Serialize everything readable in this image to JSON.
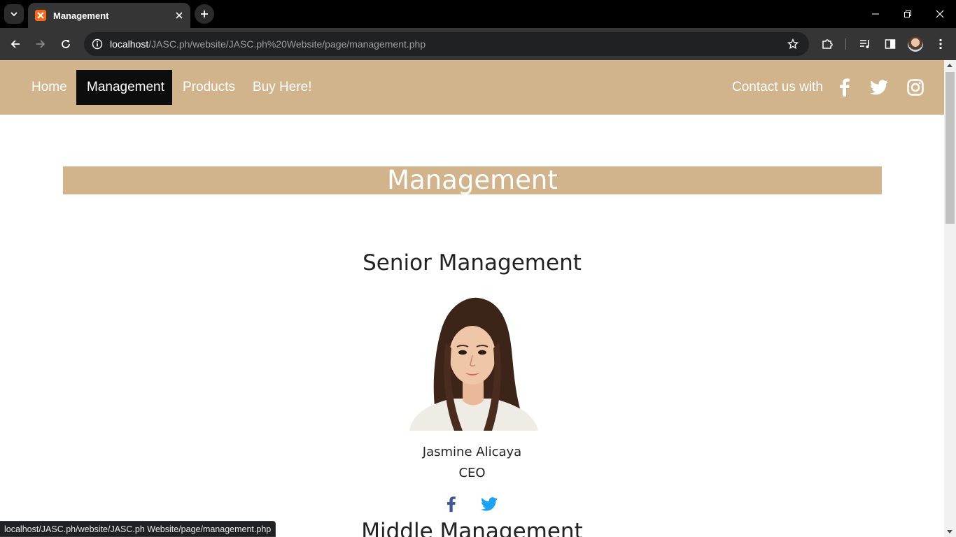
{
  "browser": {
    "tab_title": "Management",
    "url_host": "localhost",
    "url_path": "/JASC.ph/website/JASC.ph%20Website/page/management.php",
    "status_url": "localhost/JASC.ph/website/JASC.ph Website/page/management.php"
  },
  "nav": {
    "items": [
      {
        "label": "Home"
      },
      {
        "label": "Management"
      },
      {
        "label": "Products"
      },
      {
        "label": "Buy Here!"
      }
    ],
    "contact_label": "Contact us with",
    "social_icons": [
      "facebook-icon",
      "twitter-icon",
      "instagram-icon"
    ]
  },
  "page": {
    "title": "Management",
    "senior_title": "Senior Management",
    "middle_title": "Middle Management"
  },
  "person": {
    "name": "Jasmine Alicaya",
    "role": "CEO"
  },
  "colors": {
    "nav_bg": "#d2b48c",
    "active_bg": "#0d0d0d",
    "facebook": "#3b5998",
    "twitter": "#1da1f2"
  }
}
